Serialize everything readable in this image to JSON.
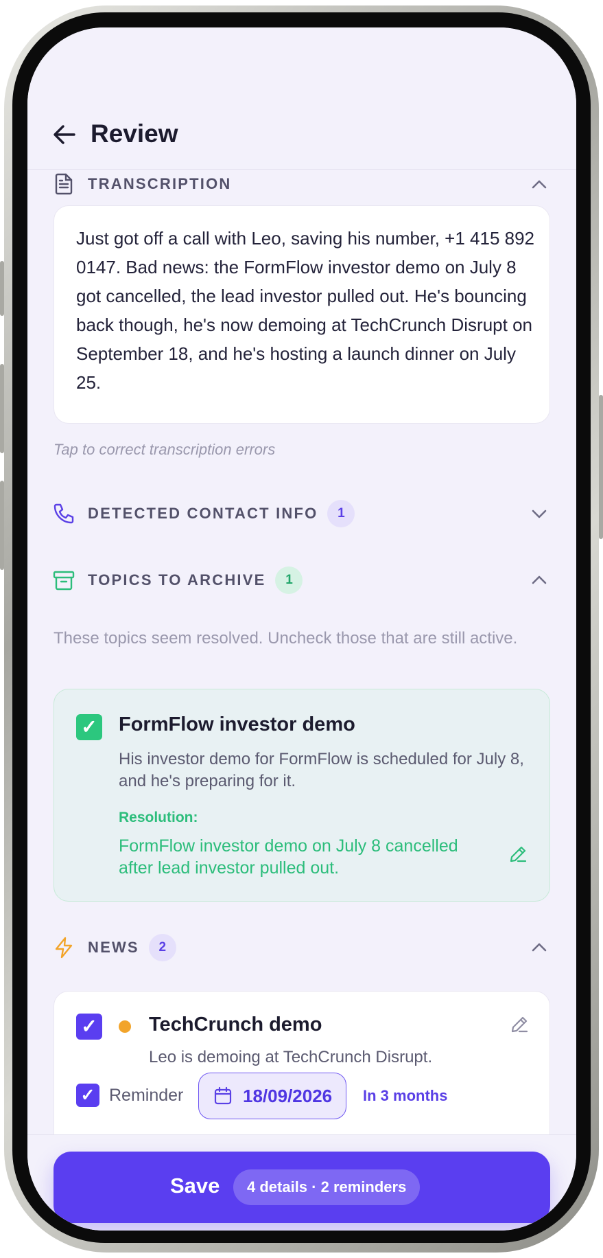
{
  "header": {
    "title": "Review"
  },
  "transcription": {
    "title": "TRANSCRIPTION",
    "text": "Just got off a call with Leo, saving his number, +1 415 892 0147. Bad news: the FormFlow investor demo on July 8 got cancelled, the lead investor pulled out. He's bouncing back though, he's now demoing at TechCrunch Disrupt on September 18, and he's hosting a launch dinner on July 25.",
    "hint": "Tap to correct transcription errors"
  },
  "contact": {
    "title": "DETECTED CONTACT INFO",
    "count": "1"
  },
  "archive": {
    "title": "TOPICS TO ARCHIVE",
    "count": "1",
    "description": "These topics seem resolved. Uncheck those that are still active.",
    "item": {
      "title": "FormFlow investor demo",
      "description": "His investor demo for FormFlow is scheduled for July 8, and he's preparing for it.",
      "resolution_label": "Resolution:",
      "resolution": "FormFlow investor demo on July 8 cancelled after lead investor pulled out.",
      "check": "✓"
    }
  },
  "news": {
    "title": "NEWS",
    "count": "2",
    "item": {
      "title": "TechCrunch demo",
      "description": "Leo is demoing at TechCrunch Disrupt.",
      "check": "✓",
      "reminder_label": "Reminder",
      "reminder_check": "✓",
      "date": "18/09/2026",
      "relative": "In 3 months"
    }
  },
  "footer": {
    "save_label": "Save",
    "summary": "4 details · 2 reminders"
  },
  "colors": {
    "accent": "#5a3ef0",
    "success": "#2cc77e",
    "warning": "#f2a42a"
  }
}
